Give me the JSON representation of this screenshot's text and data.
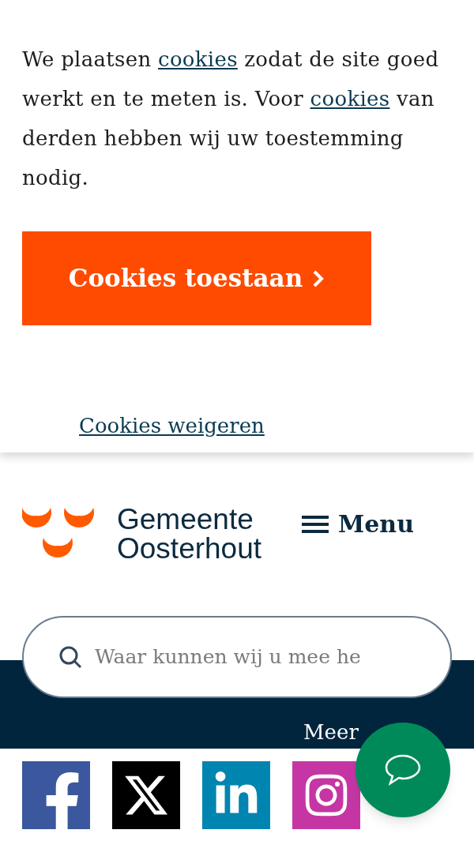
{
  "cookie_banner": {
    "message": [
      {
        "text": "We plaatsen ",
        "link": false
      },
      {
        "text": "cookies",
        "link": true
      },
      {
        "text": " zodat de site goed werkt en te meten is. Voor ",
        "link": false
      },
      {
        "text": "cookies",
        "link": true
      },
      {
        "text": " van derden hebben wij uw toestemming nodig.",
        "link": false
      }
    ],
    "accept_button": "Cookies toestaan",
    "reject_link": "Cookies weigeren"
  },
  "header": {
    "logo_lines": [
      "Gemeente",
      "Oosterhout"
    ],
    "menu_button": "Menu"
  },
  "search": {
    "placeholder": "Waar kunnen wij u mee he"
  },
  "band": {
    "text": "Meer"
  },
  "social": [
    {
      "kind": "facebook"
    },
    {
      "kind": "x"
    },
    {
      "kind": "linkedin"
    },
    {
      "kind": "instagram"
    }
  ]
}
